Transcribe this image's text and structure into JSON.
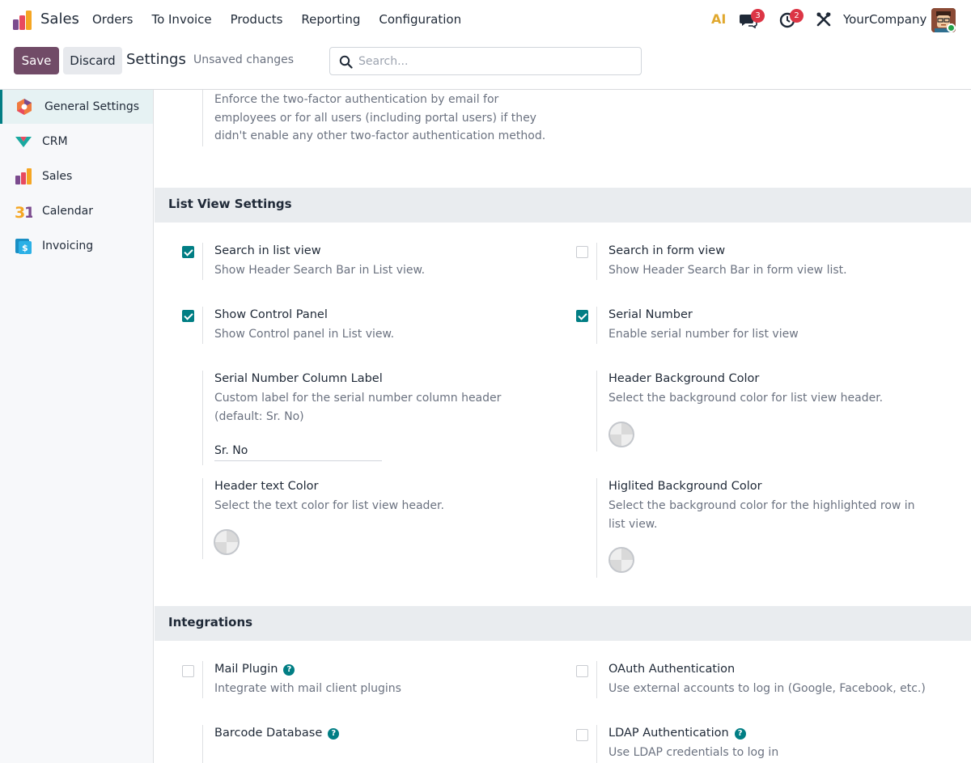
{
  "navbar": {
    "app_name": "Sales",
    "menu": [
      "Orders",
      "To Invoice",
      "Products",
      "Reporting",
      "Configuration"
    ],
    "ai_label": "AI",
    "messages_count": "3",
    "activities_count": "2",
    "company": "YourCompany"
  },
  "control_panel": {
    "save_label": "Save",
    "discard_label": "Discard",
    "title": "Settings",
    "status": "Unsaved changes",
    "search_placeholder": "Search..."
  },
  "sidebar": {
    "items": [
      {
        "label": "General Settings",
        "icon": "general-settings-icon",
        "active": true
      },
      {
        "label": "CRM",
        "icon": "crm-icon",
        "active": false
      },
      {
        "label": "Sales",
        "icon": "sales-icon",
        "active": false
      },
      {
        "label": "Calendar",
        "icon": "calendar-icon",
        "active": false
      },
      {
        "label": "Invoicing",
        "icon": "invoicing-icon",
        "active": false
      }
    ]
  },
  "top_partial": {
    "desc": "Enforce the two-factor authentication by email for employees or for all users (including portal users) if they didn't enable any other two-factor authentication method."
  },
  "list_view": {
    "header": "List View Settings",
    "search_list": {
      "title": "Search in list view",
      "desc": "Show Header Search Bar in List view.",
      "checked": true
    },
    "search_form": {
      "title": "Search in form view",
      "desc": "Show Header Search Bar in form view list.",
      "checked": false
    },
    "control_panel": {
      "title": "Show Control Panel",
      "desc": "Show Control panel in List view.",
      "checked": true
    },
    "serial_number": {
      "title": "Serial Number",
      "desc": "Enable serial number for list view",
      "checked": true
    },
    "serial_label": {
      "title": "Serial Number Column Label",
      "desc": "Custom label for the serial number column header (default: Sr. No)",
      "value": "Sr. No"
    },
    "header_bg": {
      "title": "Header Background Color",
      "desc": "Select the background color for list view header."
    },
    "header_text": {
      "title": "Header text Color",
      "desc": "Select the text color for list view header."
    },
    "highlight_bg": {
      "title": "Higlited Background Color",
      "desc": "Select the background color for the highlighted row in list view."
    }
  },
  "integrations": {
    "header": "Integrations",
    "mail_plugin": {
      "title": "Mail Plugin",
      "desc": "Integrate with mail client plugins",
      "checked": false
    },
    "oauth": {
      "title": "OAuth Authentication",
      "desc": "Use external accounts to log in (Google, Facebook, etc.)",
      "checked": false
    },
    "barcode": {
      "title": "Barcode Database"
    },
    "ldap": {
      "title": "LDAP Authentication",
      "desc": "Use LDAP credentials to log in",
      "checked": false
    }
  },
  "colors": {
    "brand": "#714b67",
    "accent": "#017e84",
    "badge": "#dc3545"
  }
}
